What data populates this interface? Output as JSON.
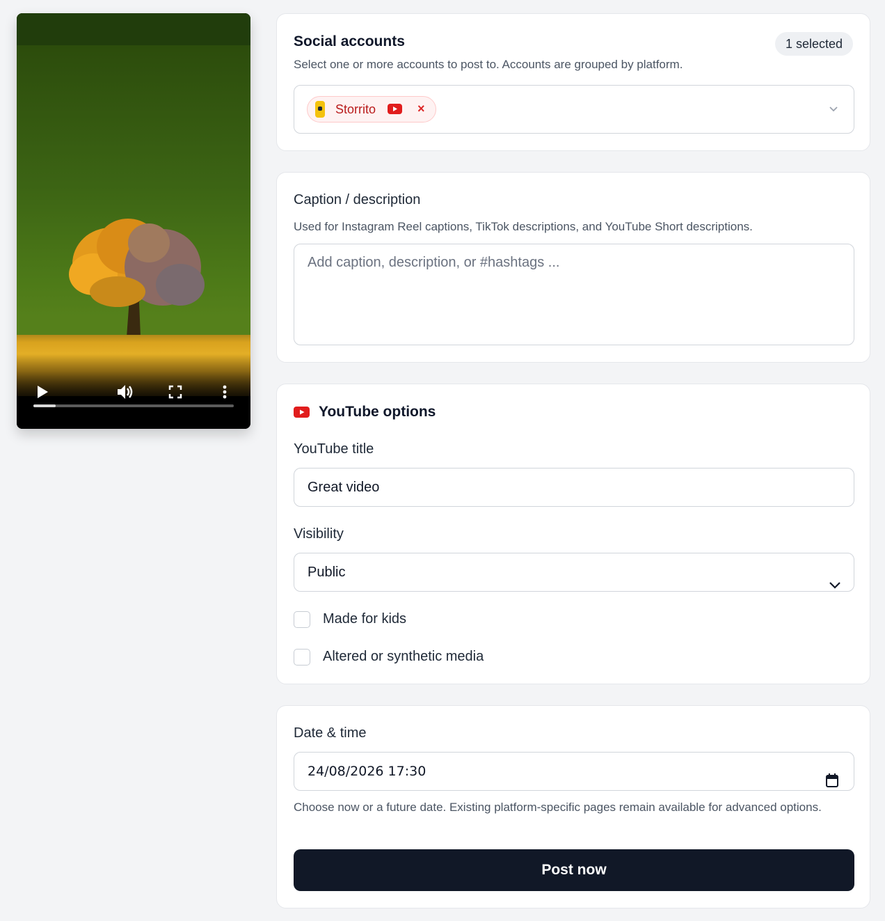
{
  "video": {
    "progress_fraction": 0.11
  },
  "social": {
    "title": "Social accounts",
    "badge": "1 selected",
    "subtitle": "Select one or more accounts to post to. Accounts are grouped by platform.",
    "chip_label": "Storrito",
    "chip_remove": "×"
  },
  "caption": {
    "title": "Caption / description",
    "hint": "Used for Instagram Reel captions, TikTok descriptions, and YouTube Short descriptions.",
    "placeholder": "Add caption, description, or #hashtags ..."
  },
  "youtube": {
    "title": "YouTube options",
    "title_label": "YouTube title",
    "title_value": "Great video",
    "visibility_label": "Visibility",
    "visibility_value": "Public",
    "made_for_kids": "Made for kids",
    "altered_media": "Altered or synthetic media"
  },
  "schedule": {
    "label": "Date & time",
    "datetime_value": "24/08/2026 17:30",
    "hint": "Choose now or a future date. Existing platform-specific pages remain available for advanced options.",
    "post_button": "Post now"
  },
  "colors": {
    "youtube_red": "#e11d1d",
    "primary_button": "#111827",
    "chip_bg": "#fef2f2"
  }
}
